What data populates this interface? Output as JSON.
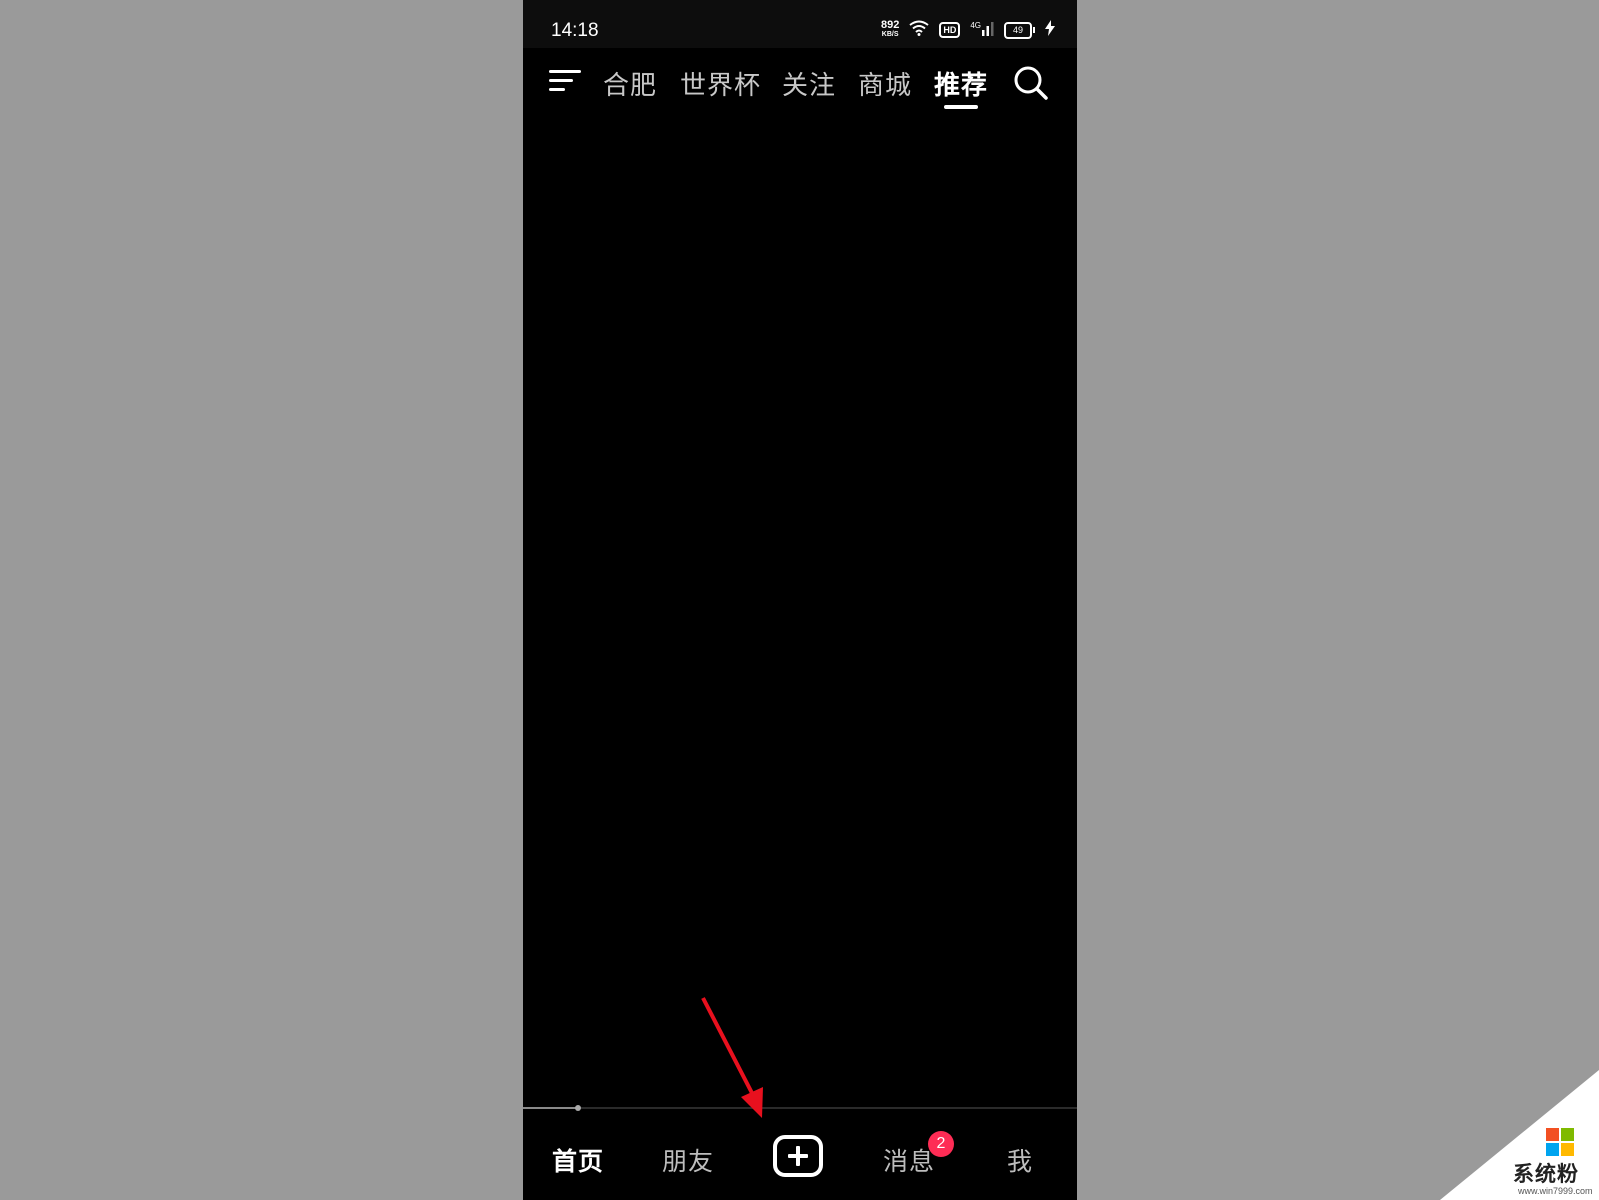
{
  "status_bar": {
    "time": "14:18",
    "network_speed_value": "892",
    "network_speed_unit": "KB/S",
    "hd_label": "HD",
    "signal_label": "4G",
    "battery_level": "49"
  },
  "top_tabs": [
    {
      "label": "合肥",
      "active": false
    },
    {
      "label": "世界杯",
      "active": false
    },
    {
      "label": "关注",
      "active": false
    },
    {
      "label": "商城",
      "active": false
    },
    {
      "label": "推荐",
      "active": true
    }
  ],
  "playback": {
    "progress_fraction": 0.1
  },
  "bottom_nav": [
    {
      "label": "首页",
      "active": true
    },
    {
      "label": "朋友",
      "active": false
    },
    {
      "label": "消息",
      "active": false,
      "badge": "2"
    },
    {
      "label": "我",
      "active": false
    }
  ],
  "icons": {
    "menu": "menu-icon",
    "search": "search-icon",
    "add": "plus-icon",
    "wifi": "wifi-icon",
    "charging": "lightning-icon"
  },
  "colors": {
    "badge": "#fe2c55",
    "annotation_arrow": "#e8101e"
  },
  "watermark": {
    "text": "系统粉",
    "url": "www.win7999.com"
  }
}
